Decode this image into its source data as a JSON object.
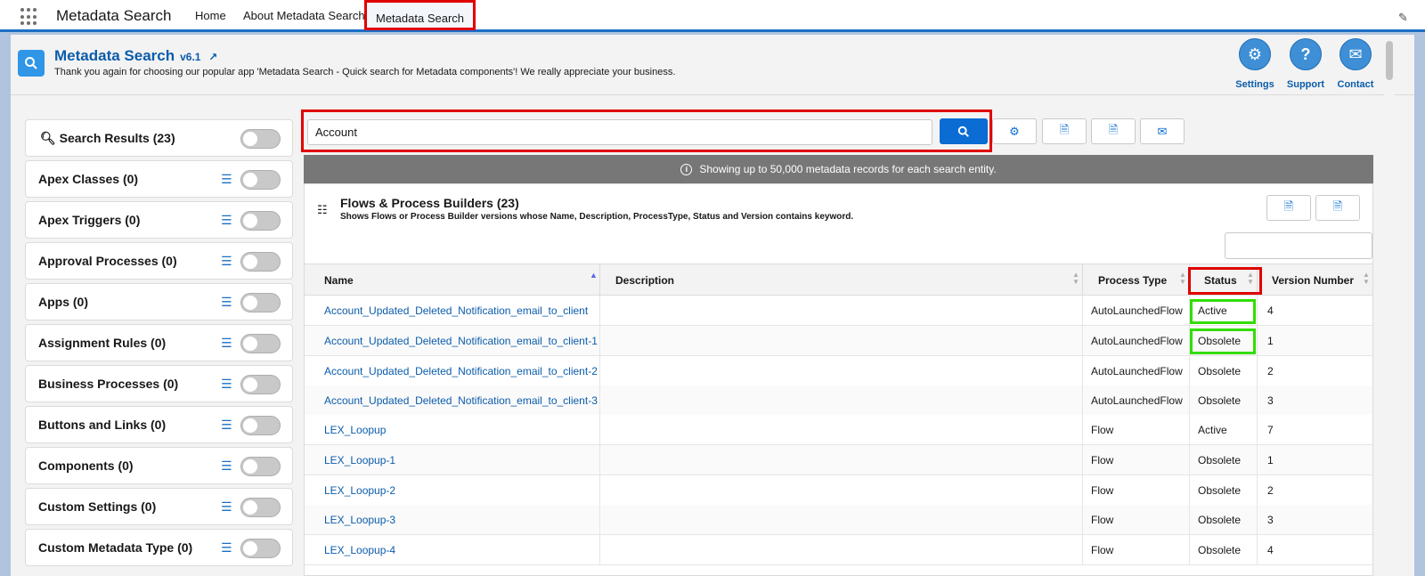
{
  "topnav": {
    "app_name": "Metadata Search",
    "items": [
      "Home",
      "About Metadata Search",
      "Metadata Search"
    ]
  },
  "header": {
    "title": "Metadata Search",
    "version": "v6.1",
    "subtitle": "Thank you again for choosing our popular app 'Metadata Search - Quick search for Metadata components'! We really appreciate your business.",
    "buttons": [
      "Settings",
      "Support",
      "Contact"
    ]
  },
  "sidebar": {
    "items": [
      "Search Results (23)",
      "Apex Classes (0)",
      "Apex Triggers (0)",
      "Approval Processes (0)",
      "Apps (0)",
      "Assignment Rules (0)",
      "Business Processes (0)",
      "Buttons and Links (0)",
      "Components (0)",
      "Custom Settings (0)",
      "Custom Metadata Type (0)"
    ]
  },
  "search": {
    "value": "Account"
  },
  "info_bar": "Showing up to 50,000 metadata records for each search entity.",
  "results": {
    "title": "Flows & Process Builders (23)",
    "subtitle": "Shows Flows or Process Builder versions whose Name, Description, ProcessType, Status and Version contains keyword.",
    "columns": [
      "Name",
      "Description",
      "Process Type",
      "Status",
      "Version Number"
    ],
    "rows": [
      {
        "name": "Account_Updated_Deleted_Notification_email_to_client",
        "description": "",
        "type": "AutoLaunchedFlow",
        "status": "Active",
        "version": "4"
      },
      {
        "name": "Account_Updated_Deleted_Notification_email_to_client-1",
        "description": "",
        "type": "AutoLaunchedFlow",
        "status": "Obsolete",
        "version": "1"
      },
      {
        "name": "Account_Updated_Deleted_Notification_email_to_client-2",
        "description": "",
        "type": "AutoLaunchedFlow",
        "status": "Obsolete",
        "version": "2"
      },
      {
        "name": "Account_Updated_Deleted_Notification_email_to_client-3",
        "description": "",
        "type": "AutoLaunchedFlow",
        "status": "Obsolete",
        "version": "3"
      },
      {
        "name": "LEX_Loopup",
        "description": "",
        "type": "Flow",
        "status": "Active",
        "version": "7"
      },
      {
        "name": "LEX_Loopup-1",
        "description": "",
        "type": "Flow",
        "status": "Obsolete",
        "version": "1"
      },
      {
        "name": "LEX_Loopup-2",
        "description": "",
        "type": "Flow",
        "status": "Obsolete",
        "version": "2"
      },
      {
        "name": "LEX_Loopup-3",
        "description": "",
        "type": "Flow",
        "status": "Obsolete",
        "version": "3"
      },
      {
        "name": "LEX_Loopup-4",
        "description": "",
        "type": "Flow",
        "status": "Obsolete",
        "version": "4"
      }
    ]
  },
  "colors": {
    "brand": "#0b5cab",
    "highlight_red": "#e00000",
    "highlight_green": "#33dd00"
  }
}
